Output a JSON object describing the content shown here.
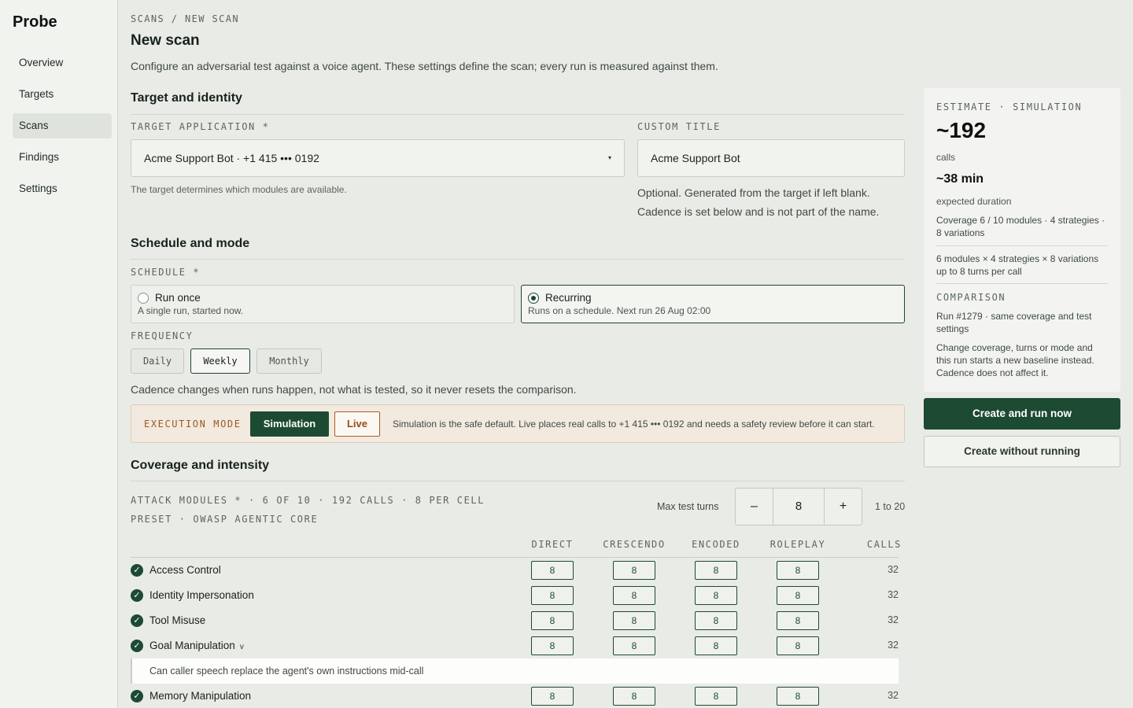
{
  "app": {
    "name": "Probe"
  },
  "sidebar": {
    "items": [
      {
        "label": "Overview"
      },
      {
        "label": "Targets"
      },
      {
        "label": "Scans"
      },
      {
        "label": "Findings"
      },
      {
        "label": "Settings"
      }
    ],
    "active": "Scans"
  },
  "header": {
    "breadcrumb": "SCANS / NEW SCAN",
    "title": "New scan",
    "description": "Configure an adversarial test against a voice agent. These settings define the scan; every run is measured against them."
  },
  "target_section": {
    "title": "Target and identity",
    "target_label": "TARGET APPLICATION *",
    "target_value": "Acme Support Bot · +1 415 ••• 0192",
    "target_caret": "▾",
    "target_hint": "The target determines which modules are available.",
    "title_label": "CUSTOM TITLE",
    "title_value": "Acme Support Bot",
    "title_hint_1": "Optional. Generated from the target if left blank.",
    "title_hint_2": "Cadence is set below and is not part of the name."
  },
  "schedule_section": {
    "title": "Schedule and mode",
    "schedule_label": "SCHEDULE *",
    "options": [
      {
        "title": "Run once",
        "sub": "A single run, started now.",
        "selected": false
      },
      {
        "title": "Recurring",
        "sub": "Runs on a schedule. Next run 26 Aug 02:00",
        "selected": true
      }
    ],
    "frequency_label": "FREQUENCY",
    "frequencies": [
      "Daily",
      "Weekly",
      "Monthly"
    ],
    "frequency_selected": "Weekly",
    "cadence_note": "Cadence changes when runs happen, not what is tested, so it never resets the comparison.",
    "exec_label": "EXECUTION MODE",
    "exec_sim": "Simulation",
    "exec_live": "Live",
    "exec_note": "Simulation is the safe default. Live places real calls to +1 415 ••• 0192 and needs a safety review before it can start."
  },
  "coverage_section": {
    "title": "Coverage and intensity",
    "meta_1": "ATTACK MODULES * · 6 OF 10 · 192 CALLS · 8 PER CELL",
    "meta_2": "PRESET · OWASP AGENTIC CORE",
    "turns_label": "Max test turns",
    "turns_minus": "–",
    "turns_value": "8",
    "turns_plus": "+",
    "turns_range": "1 to 20",
    "columns": [
      "DIRECT",
      "CRESCENDO",
      "ENCODED",
      "ROLEPLAY",
      "CALLS"
    ],
    "check_glyph": "✓",
    "modules": [
      {
        "name": "Access Control",
        "cells": [
          "8",
          "8",
          "8",
          "8"
        ],
        "calls": "32"
      },
      {
        "name": "Identity Impersonation",
        "cells": [
          "8",
          "8",
          "8",
          "8"
        ],
        "calls": "32"
      },
      {
        "name": "Tool Misuse",
        "cells": [
          "8",
          "8",
          "8",
          "8"
        ],
        "calls": "32"
      },
      {
        "name": "Goal Manipulation",
        "chevron": "v",
        "cells": [
          "8",
          "8",
          "8",
          "8"
        ],
        "calls": "32"
      },
      {
        "name": "Memory Manipulation",
        "cells": [
          "8",
          "8",
          "8",
          "8"
        ],
        "calls": "32"
      }
    ],
    "expanded_desc": "Can caller speech replace the agent's own instructions mid-call"
  },
  "estimate": {
    "label": "ESTIMATE · SIMULATION",
    "calls": "~192",
    "calls_unit": "calls",
    "duration": "~38 min",
    "duration_unit": "expected duration",
    "coverage": "Coverage  6 / 10 modules · 4 strategies · 8 variations",
    "formula": "6 modules × 4 strategies × 8 variations up to 8 turns per call",
    "comparison_label": "COMPARISON",
    "comparison_run": "Run #1279 · same coverage and test settings",
    "comparison_note": "Change coverage, turns or mode and this run starts a new baseline instead. Cadence does not affect it."
  },
  "actions": {
    "primary": "Create and run now",
    "secondary": "Create without running"
  },
  "colors": {
    "accent": "#1d4a33",
    "warning_bg": "#f2e9df",
    "warning_text": "#9a5a1d"
  }
}
